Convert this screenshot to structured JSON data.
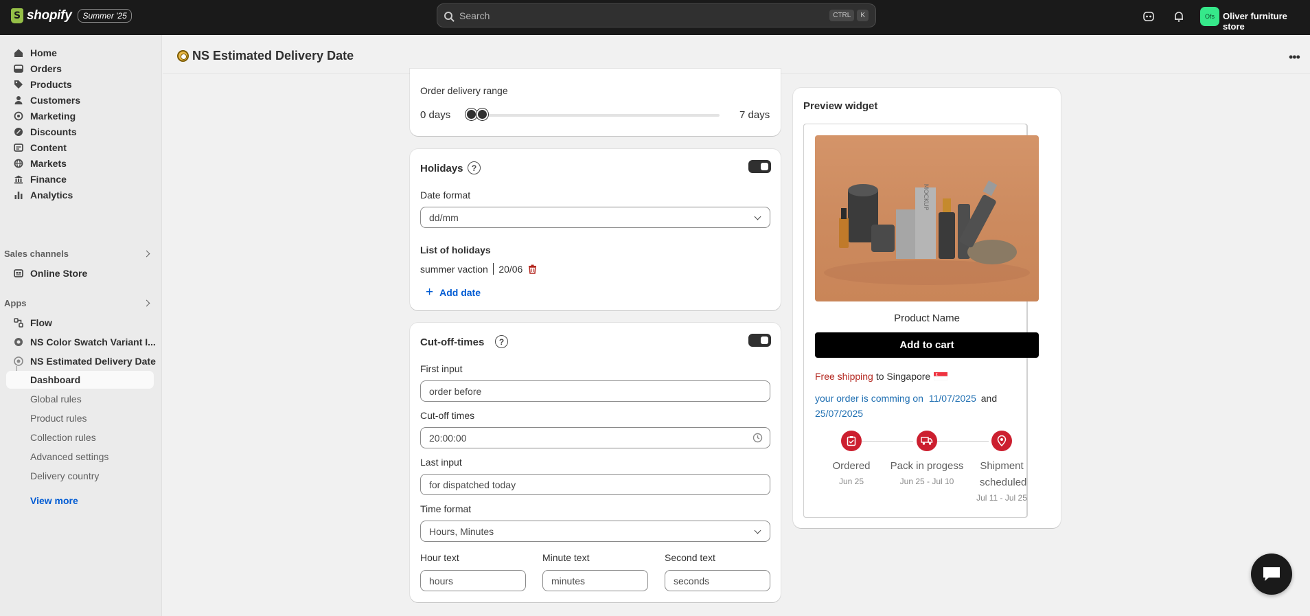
{
  "topbar": {
    "brand": "shopify",
    "edition_badge": "Summer '25",
    "search_placeholder": "Search",
    "shortcut_keys": [
      "CTRL",
      "K"
    ],
    "store_initials": "Ofs",
    "store_name": "Oliver furniture store"
  },
  "sidebar": {
    "main_items": [
      {
        "label": "Home",
        "icon": "home-icon"
      },
      {
        "label": "Orders",
        "icon": "orders-icon"
      },
      {
        "label": "Products",
        "icon": "tag-icon"
      },
      {
        "label": "Customers",
        "icon": "person-icon"
      },
      {
        "label": "Marketing",
        "icon": "target-icon"
      },
      {
        "label": "Discounts",
        "icon": "discount-icon"
      },
      {
        "label": "Content",
        "icon": "content-icon"
      },
      {
        "label": "Markets",
        "icon": "globe-icon"
      },
      {
        "label": "Finance",
        "icon": "bank-icon"
      },
      {
        "label": "Analytics",
        "icon": "bar-chart-icon"
      }
    ],
    "sales_channels_label": "Sales channels",
    "online_store": "Online Store",
    "apps_label": "Apps",
    "apps": [
      {
        "label": "Flow"
      },
      {
        "label": "NS Color Swatch Variant I..."
      },
      {
        "label": "NS Estimated Delivery Date"
      }
    ],
    "sub_items": [
      {
        "label": "Dashboard"
      },
      {
        "label": "Global rules"
      },
      {
        "label": "Product rules"
      },
      {
        "label": "Collection rules"
      },
      {
        "label": "Advanced settings"
      },
      {
        "label": "Delivery country"
      }
    ],
    "view_more": "View more"
  },
  "page": {
    "title": "NS Estimated Delivery Date"
  },
  "range_card": {
    "label": "Order delivery range",
    "min_label": "0 days",
    "max_label": "7 days"
  },
  "holidays": {
    "title": "Holidays",
    "enabled": true,
    "date_format_label": "Date format",
    "date_format_value": "dd/mm",
    "list_label": "List of holidays",
    "holiday_name": "summer vaction",
    "holiday_date": "20/06",
    "add_date": "Add date"
  },
  "cutoff": {
    "title": "Cut-off-times",
    "enabled": true,
    "first_input_label": "First input",
    "first_input_value": "order before",
    "cutoff_label": "Cut-off times",
    "cutoff_value": "20:00:00",
    "last_input_label": "Last input",
    "last_input_value": "for dispatched today",
    "time_format_label": "Time format",
    "time_format_value": "Hours, Minutes",
    "hour_label": "Hour text",
    "hour_value": "hours",
    "minute_label": "Minute text",
    "minute_value": "minutes",
    "second_label": "Second text",
    "second_value": "seconds"
  },
  "preview": {
    "title": "Preview widget",
    "product_name": "Product Name",
    "add_to_cart": "Add to cart",
    "free_shipping": "Free shipping",
    "to_country": "to Singapore",
    "order_text": "your order is comming on",
    "date_start": "11/07/2025",
    "and": "and",
    "date_end": "25/07/2025",
    "steps": [
      {
        "label": "Ordered",
        "date": "Jun 25"
      },
      {
        "label": "Pack in progess",
        "date": "Jun 25 - Jul 10"
      },
      {
        "label": "Shipment scheduled",
        "date": "Jul 11 - Jul 25"
      }
    ],
    "product_box_text": "MOCKUP"
  },
  "colors": {
    "accent_blue": "#005bd3",
    "free_shipping_red": "#b3261e",
    "order_blue": "#1f6fb2",
    "step_red": "#cc1f2f"
  }
}
